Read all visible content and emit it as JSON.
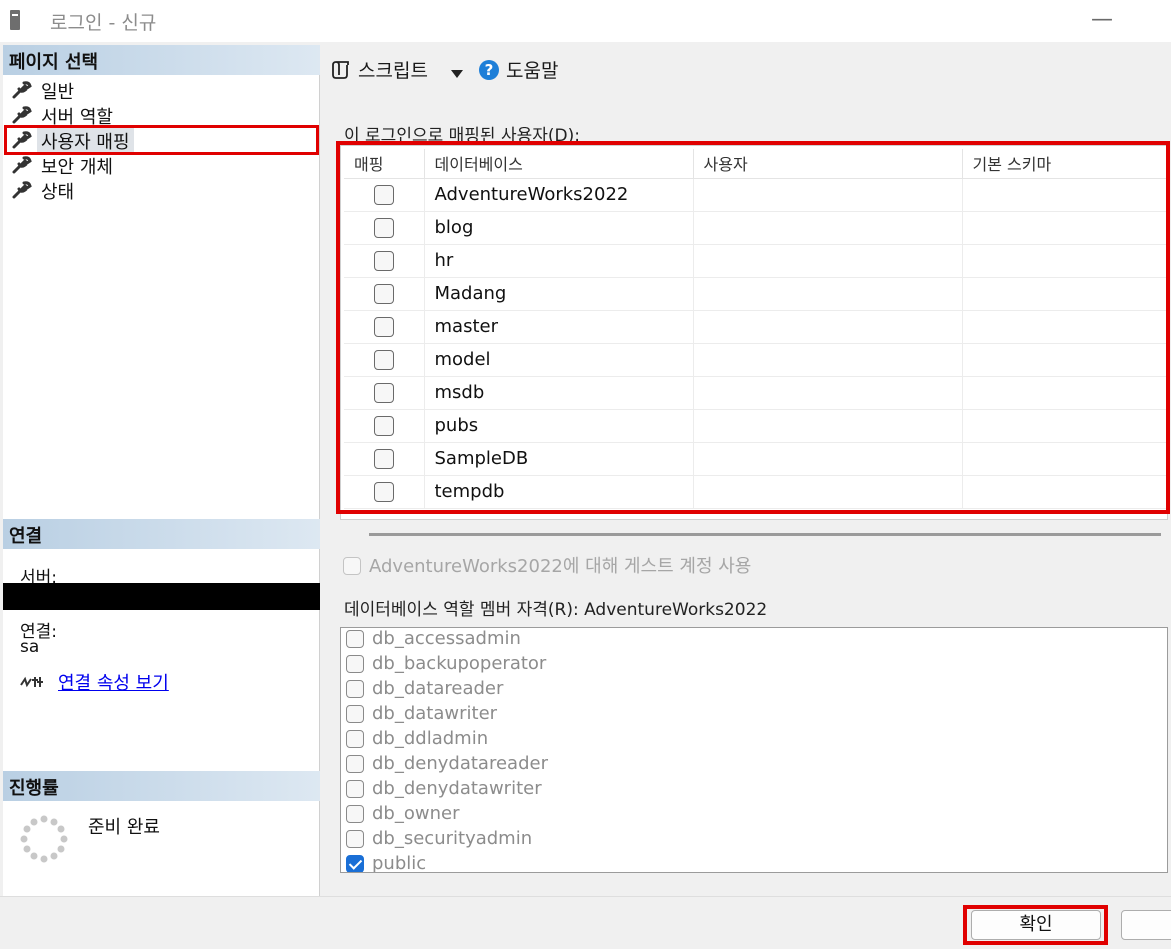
{
  "window": {
    "title": "로그인 - 신규",
    "minimize": "—"
  },
  "left": {
    "page_select_header": "페이지 선택",
    "nav_items": [
      "일반",
      "서버 역할",
      "사용자 매핑",
      "보안 개체",
      "상태"
    ],
    "selected_index": 2,
    "connection_header": "연결",
    "server_label": "서버:",
    "connection_label": "연결:",
    "connection_value": "sa",
    "view_connection_props": "연결 속성 보기",
    "progress_header": "진행률",
    "progress_status": "준비 완료"
  },
  "toolbar": {
    "script": "스크립트",
    "help": "도움말"
  },
  "mapping": {
    "title": "이 로그인으로 매핑된 사용자(D):",
    "columns": [
      "매핑",
      "데이터베이스",
      "사용자",
      "기본 스키마"
    ],
    "rows": [
      {
        "db": "AdventureWorks2022",
        "user": "",
        "schema": "",
        "mapped": false
      },
      {
        "db": "blog",
        "user": "",
        "schema": "",
        "mapped": false
      },
      {
        "db": "hr",
        "user": "",
        "schema": "",
        "mapped": false
      },
      {
        "db": "Madang",
        "user": "",
        "schema": "",
        "mapped": false
      },
      {
        "db": "master",
        "user": "",
        "schema": "",
        "mapped": false
      },
      {
        "db": "model",
        "user": "",
        "schema": "",
        "mapped": false
      },
      {
        "db": "msdb",
        "user": "",
        "schema": "",
        "mapped": false
      },
      {
        "db": "pubs",
        "user": "",
        "schema": "",
        "mapped": false
      },
      {
        "db": "SampleDB",
        "user": "",
        "schema": "",
        "mapped": false
      },
      {
        "db": "tempdb",
        "user": "",
        "schema": "",
        "mapped": false
      }
    ]
  },
  "guest": {
    "label": "AdventureWorks2022에 대해 게스트 계정 사용",
    "enabled": false
  },
  "roles": {
    "title": "데이터베이스 역할 멤버 자격(R): AdventureWorks2022",
    "items": [
      {
        "name": "db_accessadmin",
        "checked": false
      },
      {
        "name": "db_backupoperator",
        "checked": false
      },
      {
        "name": "db_datareader",
        "checked": false
      },
      {
        "name": "db_datawriter",
        "checked": false
      },
      {
        "name": "db_ddladmin",
        "checked": false
      },
      {
        "name": "db_denydatareader",
        "checked": false
      },
      {
        "name": "db_denydatawriter",
        "checked": false
      },
      {
        "name": "db_owner",
        "checked": false
      },
      {
        "name": "db_securityadmin",
        "checked": false
      },
      {
        "name": "public",
        "checked": true
      }
    ]
  },
  "buttons": {
    "ok": "확인"
  },
  "colors": {
    "highlight_red": "#e00000",
    "header_blue": "#b9cfe3",
    "link_blue": "#0000ee",
    "check_blue": "#1a6fd6"
  }
}
